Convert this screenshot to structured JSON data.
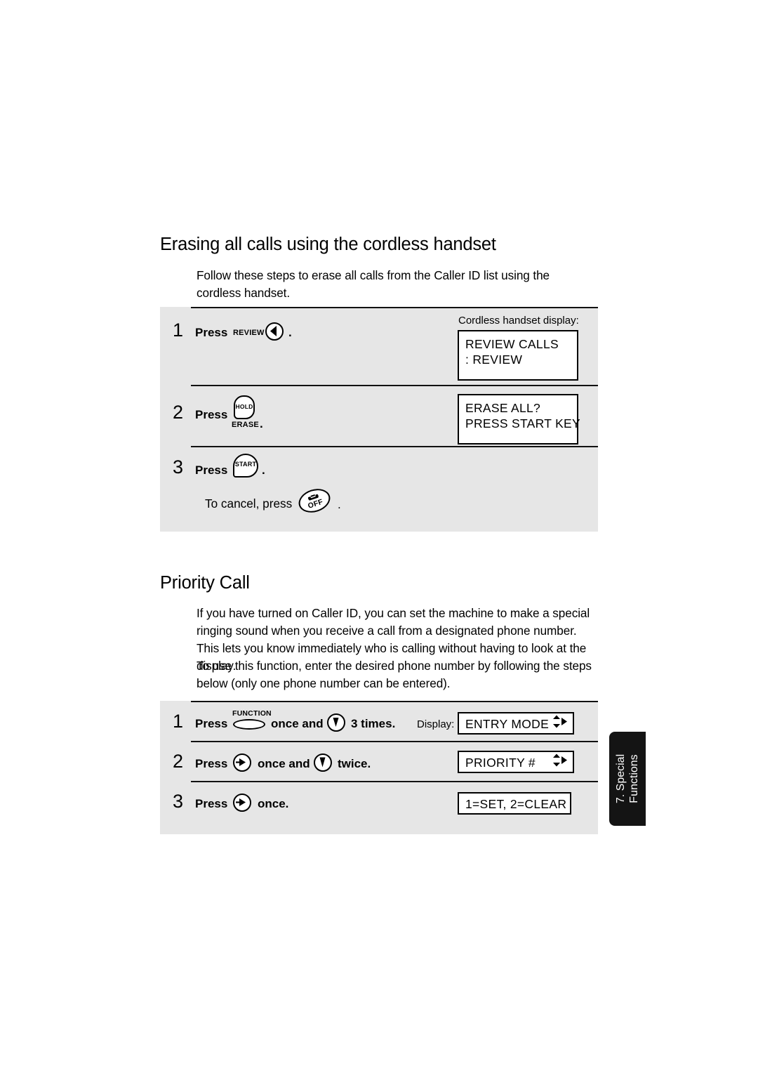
{
  "page": {
    "side_tab": {
      "line1": "7. Special",
      "line2": "Functions"
    }
  },
  "sections": [
    {
      "id": "erasing",
      "heading": "Erasing all calls using the cordless handset",
      "intro": "Follow these steps to erase all calls from the Caller ID list using the cordless handset.",
      "display_caption": "Cordless handset display:",
      "steps": [
        {
          "number": "1",
          "press_label": "Press",
          "key_caption": "REVIEW",
          "key_icon": "circle-left-arrow-icon",
          "period": ".",
          "display_lines": [
            "REVIEW CALLS",
            "   : REVIEW"
          ]
        },
        {
          "number": "2",
          "press_label": "Press",
          "key_top_text": "HOLD",
          "key_bottom_text": "ERASE",
          "key_icon": "hold-erase-key-icon",
          "period": ".",
          "display_lines": [
            "ERASE ALL?",
            "PRESS START KEY"
          ]
        },
        {
          "number": "3",
          "press_label": "Press",
          "key_text": "START",
          "key_icon": "start-key-icon",
          "period": ".",
          "cancel_text": "To cancel, press",
          "cancel_key_text": "OFF",
          "cancel_key_icon": "off-key-icon",
          "cancel_period": "."
        }
      ]
    },
    {
      "id": "priority",
      "heading": "Priority Call",
      "paragraph_1": "If you have turned on Caller ID, you can set the machine to make a special ringing sound when you receive a call from a designated phone number. This lets you know immediately who is calling without having to look at the display.",
      "paragraph_2": "To use this function, enter the desired phone number by following the steps below (only one phone number can be entered).",
      "display_caption": "Display:",
      "steps": [
        {
          "number": "1",
          "press_label": "Press",
          "key_caption": "FUNCTION",
          "key_icon": "function-oval-key-icon",
          "mid_text": "once and",
          "second_key_icon": "circle-down-arrow-icon",
          "tail_text": "3 times.",
          "display_text": "ENTRY MODE",
          "display_arrows": true
        },
        {
          "number": "2",
          "press_label": "Press",
          "key_icon": "circle-right-arrow-icon",
          "mid_text": "once and",
          "second_key_icon": "circle-down-arrow-icon",
          "tail_text": "twice.",
          "display_text": "PRIORITY #",
          "display_arrows": true
        },
        {
          "number": "3",
          "press_label": "Press",
          "key_icon": "circle-right-arrow-icon",
          "tail_text": "once.",
          "display_text": "1=SET, 2=CLEAR",
          "display_arrows": false
        }
      ]
    }
  ],
  "colors": {
    "block_background": "#e6e6e6",
    "ink": "#000000",
    "tab_background": "#141414",
    "page_background": "#ffffff"
  }
}
